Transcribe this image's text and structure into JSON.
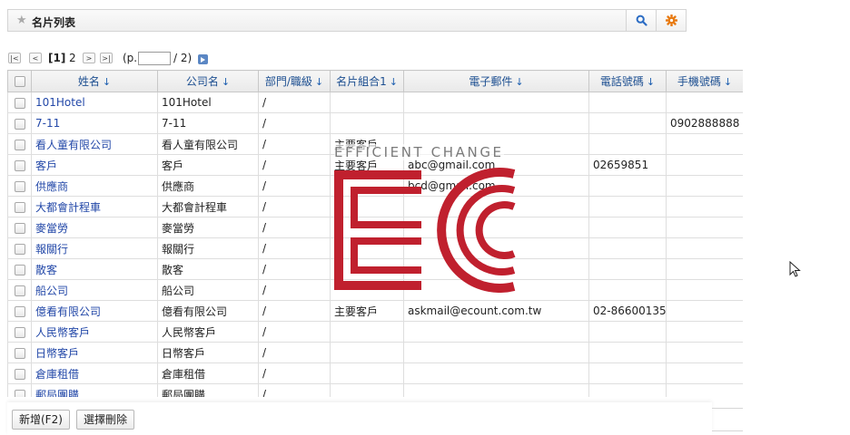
{
  "header": {
    "title": "名片列表",
    "icons": {
      "star": "star-icon",
      "search": "search-icon",
      "settings": "gear-icon"
    },
    "accent_search": "#2b6cc4",
    "accent_settings": "#e87a10"
  },
  "pager": {
    "current_page": "[1]",
    "next_page": "2",
    "input_prefix": "(p.",
    "input_value": "",
    "input_suffix": "/ 2)",
    "buttons": [
      "first-page",
      "prev-page",
      "next-page",
      "last-page",
      "go-page"
    ]
  },
  "table": {
    "columns": [
      {
        "label": "姓名",
        "sort": "↓"
      },
      {
        "label": "公司名",
        "sort": "↓"
      },
      {
        "label": "部門/職級",
        "sort": "↓"
      },
      {
        "label": "名片組合1",
        "sort": "↓"
      },
      {
        "label": "電子郵件",
        "sort": "↓"
      },
      {
        "label": "電話號碼",
        "sort": "↓"
      },
      {
        "label": "手機號碼",
        "sort": "↓"
      }
    ],
    "rows": [
      [
        "101Hotel",
        "101Hotel",
        "/",
        "",
        "",
        "",
        ""
      ],
      [
        "7-11",
        "7-11",
        "/",
        "",
        "",
        "",
        "0902888888"
      ],
      [
        "看人童有限公司",
        "看人童有限公司",
        "/",
        "主要客戶",
        "",
        "",
        ""
      ],
      [
        "客戶",
        "客戶",
        "/",
        "主要客戶",
        "abc@gmail.com",
        "02659851",
        ""
      ],
      [
        "供應商",
        "供應商",
        "/",
        "",
        "bcd@gmail.com",
        "",
        ""
      ],
      [
        "大都會計程車",
        "大都會計程車",
        "/",
        "",
        "",
        "",
        ""
      ],
      [
        "麥當勞",
        "麥當勞",
        "/",
        "",
        "",
        "",
        ""
      ],
      [
        "報關行",
        "報關行",
        "/",
        "",
        "",
        "",
        ""
      ],
      [
        "散客",
        "散客",
        "/",
        "",
        "",
        "",
        ""
      ],
      [
        "船公司",
        "船公司",
        "/",
        "",
        "",
        "",
        ""
      ],
      [
        "億看有限公司",
        "億看有限公司",
        "/",
        "主要客戶",
        "askmail@ecount.com.tw",
        "02-86600135",
        ""
      ],
      [
        "人民幣客戶",
        "人民幣客戶",
        "/",
        "",
        "",
        "",
        ""
      ],
      [
        "日幣客戶",
        "日幣客戶",
        "/",
        "",
        "",
        "",
        ""
      ],
      [
        "倉庫租借",
        "倉庫租借",
        "/",
        "",
        "",
        "",
        ""
      ],
      [
        "郵局團購",
        "郵局團購",
        "/",
        "",
        "",
        "",
        ""
      ]
    ]
  },
  "watermark": {
    "tagline": "EFFICIENT CHANGE",
    "brand_color": "#c0202e"
  },
  "footer": {
    "new_label": "新增(F2)",
    "delete_label": "選擇刪除"
  }
}
